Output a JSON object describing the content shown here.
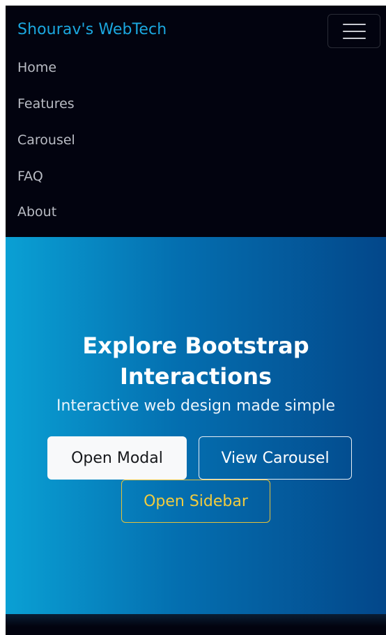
{
  "navbar": {
    "brand": "Shourav's WebTech",
    "toggler_icon": "hamburger-menu-icon",
    "items": [
      {
        "label": "Home"
      },
      {
        "label": "Features"
      },
      {
        "label": "Carousel"
      },
      {
        "label": "FAQ"
      },
      {
        "label": "About"
      }
    ]
  },
  "hero": {
    "title_line1": "Explore Bootstrap",
    "title_line2": "Interactions",
    "subtitle": "Interactive web design made simple",
    "buttons": {
      "modal": "Open Modal",
      "carousel": "View Carousel",
      "sidebar": "Open Sidebar"
    }
  },
  "colors": {
    "navbar_bg": "#02030f",
    "brand": "#1ba7df",
    "hero_gradient_start": "#0aa0d4",
    "hero_gradient_end": "#03478a",
    "warning": "#f2cc3e"
  }
}
